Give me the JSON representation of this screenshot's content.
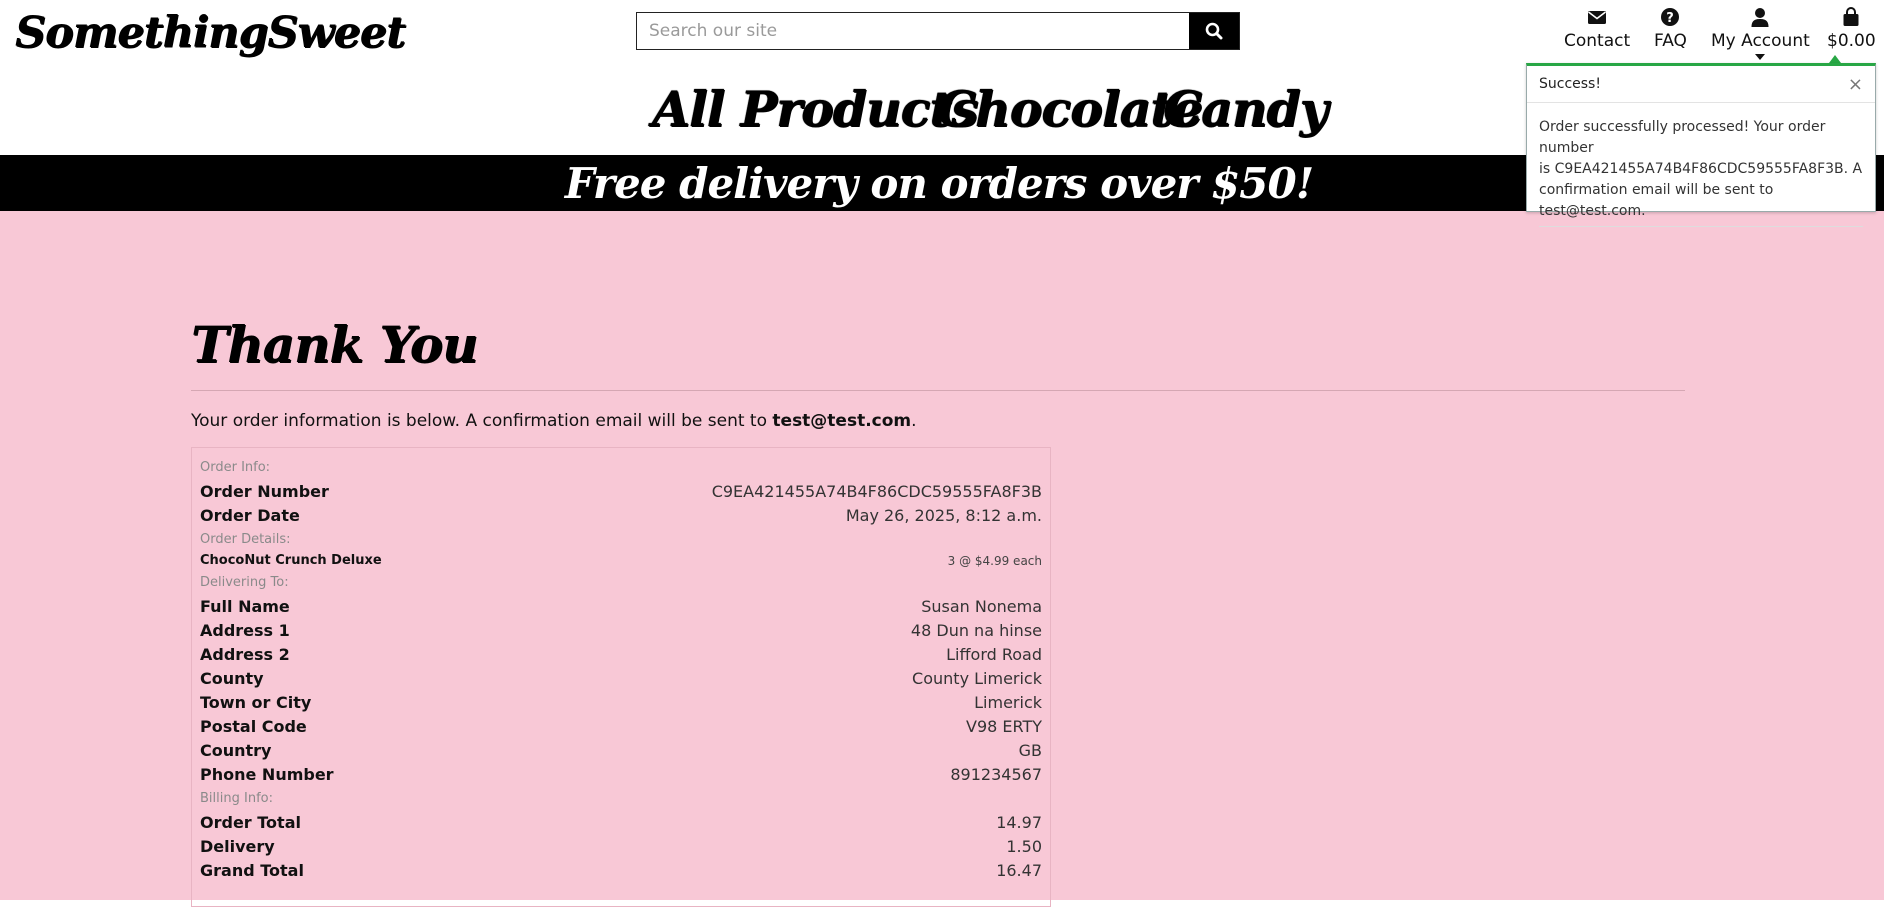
{
  "header": {
    "brand": "SomethingSweet",
    "search": {
      "placeholder": "Search our site",
      "value": ""
    },
    "nav": {
      "contact": "Contact",
      "faq": "FAQ",
      "account": "My Account",
      "cart": "$0.00"
    }
  },
  "categories": [
    "All Products",
    "Chocolate",
    "Candy"
  ],
  "banner": "Free delivery on orders over $50!",
  "toast": {
    "title": "Success!",
    "close": "×",
    "message_lines": [
      "Order successfully processed! Your order number",
      "is C9EA421455A74B4F86CDC59555FA8F3B. A",
      "confirmation email will be sent to test@test.com."
    ]
  },
  "page": {
    "title": "Thank You",
    "intro": "Your order information is below. A confirmation email will be sent to ",
    "intro_email": "test@test.com",
    "intro_end": "."
  },
  "order": {
    "order_info_label": "Order Info:",
    "order_number_label": "Order Number",
    "order_number": "C9EA421455A74B4F86CDC59555FA8F3B",
    "order_date_label": "Order Date",
    "order_date": "May 26, 2025, 8:12 a.m.",
    "details_label": "Order Details:",
    "item_name": "ChocoNut Crunch Deluxe",
    "item_qty": "3 @ $4.99 each",
    "delivering_label": "Delivering To:",
    "full_name_label": "Full Name",
    "full_name": "Susan Nonema",
    "address1_label": "Address 1",
    "address1": "48 Dun na hinse",
    "address2_label": "Address 2",
    "address2": "Lifford Road",
    "county_label": "County",
    "county": "County Limerick",
    "town_label": "Town or City",
    "town": "Limerick",
    "postcode_label": "Postal Code",
    "postcode": "V98 ERTY",
    "country_label": "Country",
    "country": "GB",
    "phone_label": "Phone Number",
    "phone": "891234567",
    "billing_label": "Billing Info:",
    "order_total_label": "Order Total",
    "order_total": "14.97",
    "delivery_label": "Delivery",
    "delivery": "1.50",
    "grand_total_label": "Grand Total",
    "grand_total": "16.47"
  },
  "colors": {
    "page_bg": "#f8c8d6",
    "banner_bg": "#000000",
    "toast_accent": "#28a745"
  },
  "icons": [
    "search-icon",
    "envelope-icon",
    "question-circle-icon",
    "user-icon",
    "shopping-bag-icon",
    "close-icon"
  ]
}
